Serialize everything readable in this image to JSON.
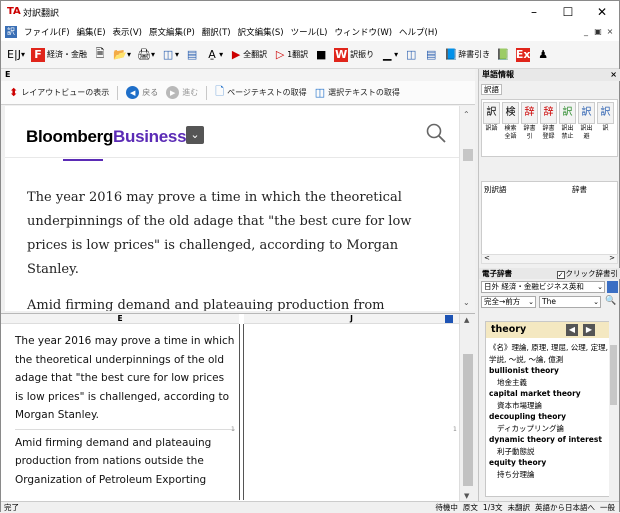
{
  "window": {
    "title": "対訳翻訳"
  },
  "menu": [
    "ファイル(F)",
    "編集(E)",
    "表示(V)",
    "原文編集(P)",
    "翻訳(T)",
    "訳文編集(S)",
    "ツール(L)",
    "ウィンドウ(W)",
    "ヘルプ(H)"
  ],
  "toolbar": {
    "domain_label": "経済・金融",
    "translate_all": "全翻訳",
    "translate_line": "1翻訳",
    "back_translate": "訳振り",
    "dictionary": "辞書引き"
  },
  "pane_e_label": "E",
  "layout_bar": {
    "layout_view": "レイアウトビューの表示",
    "back": "戻る",
    "forward": "進む",
    "get_page_text": "ページテキストの取得",
    "get_selected_text": "選択テキストの取得"
  },
  "web": {
    "logo_part1": "Bloomberg",
    "logo_part2": "Business",
    "paragraphs": [
      "The year 2016 may prove a time in which the theoretical underpinnings of the old adage that \"the best cure for low prices is low prices\" is challenged, according to Morgan Stanley.",
      "Amid firming demand and plateauing production from"
    ]
  },
  "split": {
    "col_e_head": "E",
    "col_j_head": "J",
    "paragraphs": [
      "The year 2016 may prove a time in which the theoretical underpinnings of the old adage that \"the best cure for low prices is low prices\" is challenged, according to Morgan Stanley.",
      "Amid firming demand and plateauing production from nations outside the Organization of Petroleum Exporting"
    ],
    "row_markers": [
      "1",
      "1"
    ]
  },
  "dock": {
    "title": "単語情報",
    "close": "×",
    "sub_tab": "訳語",
    "tools": [
      {
        "icon": "訳",
        "label": "訳語"
      },
      {
        "icon": "検",
        "label": "検索全語"
      },
      {
        "icon": "辞",
        "label": "辞書引"
      },
      {
        "icon": "辞",
        "label": "辞書登録"
      },
      {
        "icon": "訳",
        "label": "訳出禁止"
      },
      {
        "icon": "訳",
        "label": "訳出避"
      },
      {
        "icon": "訳",
        "label": "訳"
      }
    ],
    "list_cols": [
      "別訳語",
      "辞書"
    ],
    "edict_title": "電子辞書",
    "click_dict": "クリック辞書引",
    "dict_select": "日外 経済・金融ビジネス英和",
    "match_select": "完全→前方",
    "query": "The",
    "headword": "theory",
    "entries": [
      {
        "type": "def",
        "text": "《名》理論, 原理, 理屈, 公理, 定理, 学説, ～説, ～論, 億測"
      },
      {
        "type": "en",
        "text": "bullionist theory"
      },
      {
        "type": "ja",
        "text": "地金主義"
      },
      {
        "type": "en",
        "text": "capital market theory"
      },
      {
        "type": "ja",
        "text": "資本市場理論"
      },
      {
        "type": "en",
        "text": "decoupling theory"
      },
      {
        "type": "ja",
        "text": "ディカップリング論"
      },
      {
        "type": "en",
        "text": "dynamic theory of interest"
      },
      {
        "type": "ja",
        "text": "利子動態説"
      },
      {
        "type": "en",
        "text": "equity theory"
      },
      {
        "type": "ja",
        "text": "持ち分理論"
      }
    ]
  },
  "status": {
    "left": "完了",
    "items": [
      "待機中",
      "原文",
      "1/3文",
      "未翻訳",
      "英語から日本語へ",
      "一般"
    ]
  }
}
